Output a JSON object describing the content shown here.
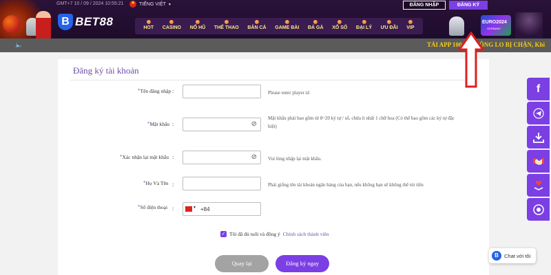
{
  "header": {
    "datetime": "GMT+7 10 / 09 / 2024 10:55:21",
    "language": "TIẾNG VIỆT",
    "login_label": "ĐĂNG NHẬP",
    "register_label": "ĐĂNG KÝ",
    "logo_mark": "B",
    "logo_text": "BET88",
    "euro_badge": "EURO2024",
    "euro_sub": "GERMANY"
  },
  "nav": {
    "items": [
      "HOT",
      "CASINO",
      "NỔ HŨ",
      "THỂ THAO",
      "BẮN CÁ",
      "GAME BÀI",
      "ĐÁ GÀ",
      "XỔ SỐ",
      "ĐẠI LÝ",
      "ƯU ĐÃI",
      "VIP"
    ]
  },
  "marquee": {
    "text": "TẢI APP 100% KHÔNG LO BỊ CHẶN, Khi"
  },
  "form": {
    "title": "Đăng ký tài khoản",
    "fields": [
      {
        "label": "Tên đăng nhập",
        "value": "",
        "hint": "Please enter player id"
      },
      {
        "label": "Mật khẩu",
        "value": "",
        "hint": "Mật khẩu phải bao gồm từ 8~20 ký tự / số, chứa ít nhất 1 chữ hoa (Có thể bao gồm các ký tự đặc biệt)"
      },
      {
        "label": "Xác nhận lại mật khẩu",
        "value": "",
        "hint": "Vui lòng nhập lại mật khẩu."
      },
      {
        "label": "Họ Và Tên",
        "value": "",
        "hint": "Phải giống tên tài khoản ngân hàng của bạn, nếu không bạn sẽ không thể rút tiền"
      },
      {
        "label": "Số điện thoại",
        "value": "+84",
        "hint": ""
      }
    ],
    "agree_text": "Tôi đã đủ tuổi và đồng ý",
    "policy_link": "Chính sách thành viên",
    "back_label": "Quay lại",
    "submit_label": "Đăng ký ngay"
  },
  "chat": {
    "logo_mark": "B",
    "label": "Chat với tôi"
  },
  "colors": {
    "brand_purple": "#7b3fe4",
    "header_dark": "#2a1238",
    "nav_text": "#fde68a",
    "marquee_text": "#facc15",
    "arrow_red": "#e11d1d"
  }
}
